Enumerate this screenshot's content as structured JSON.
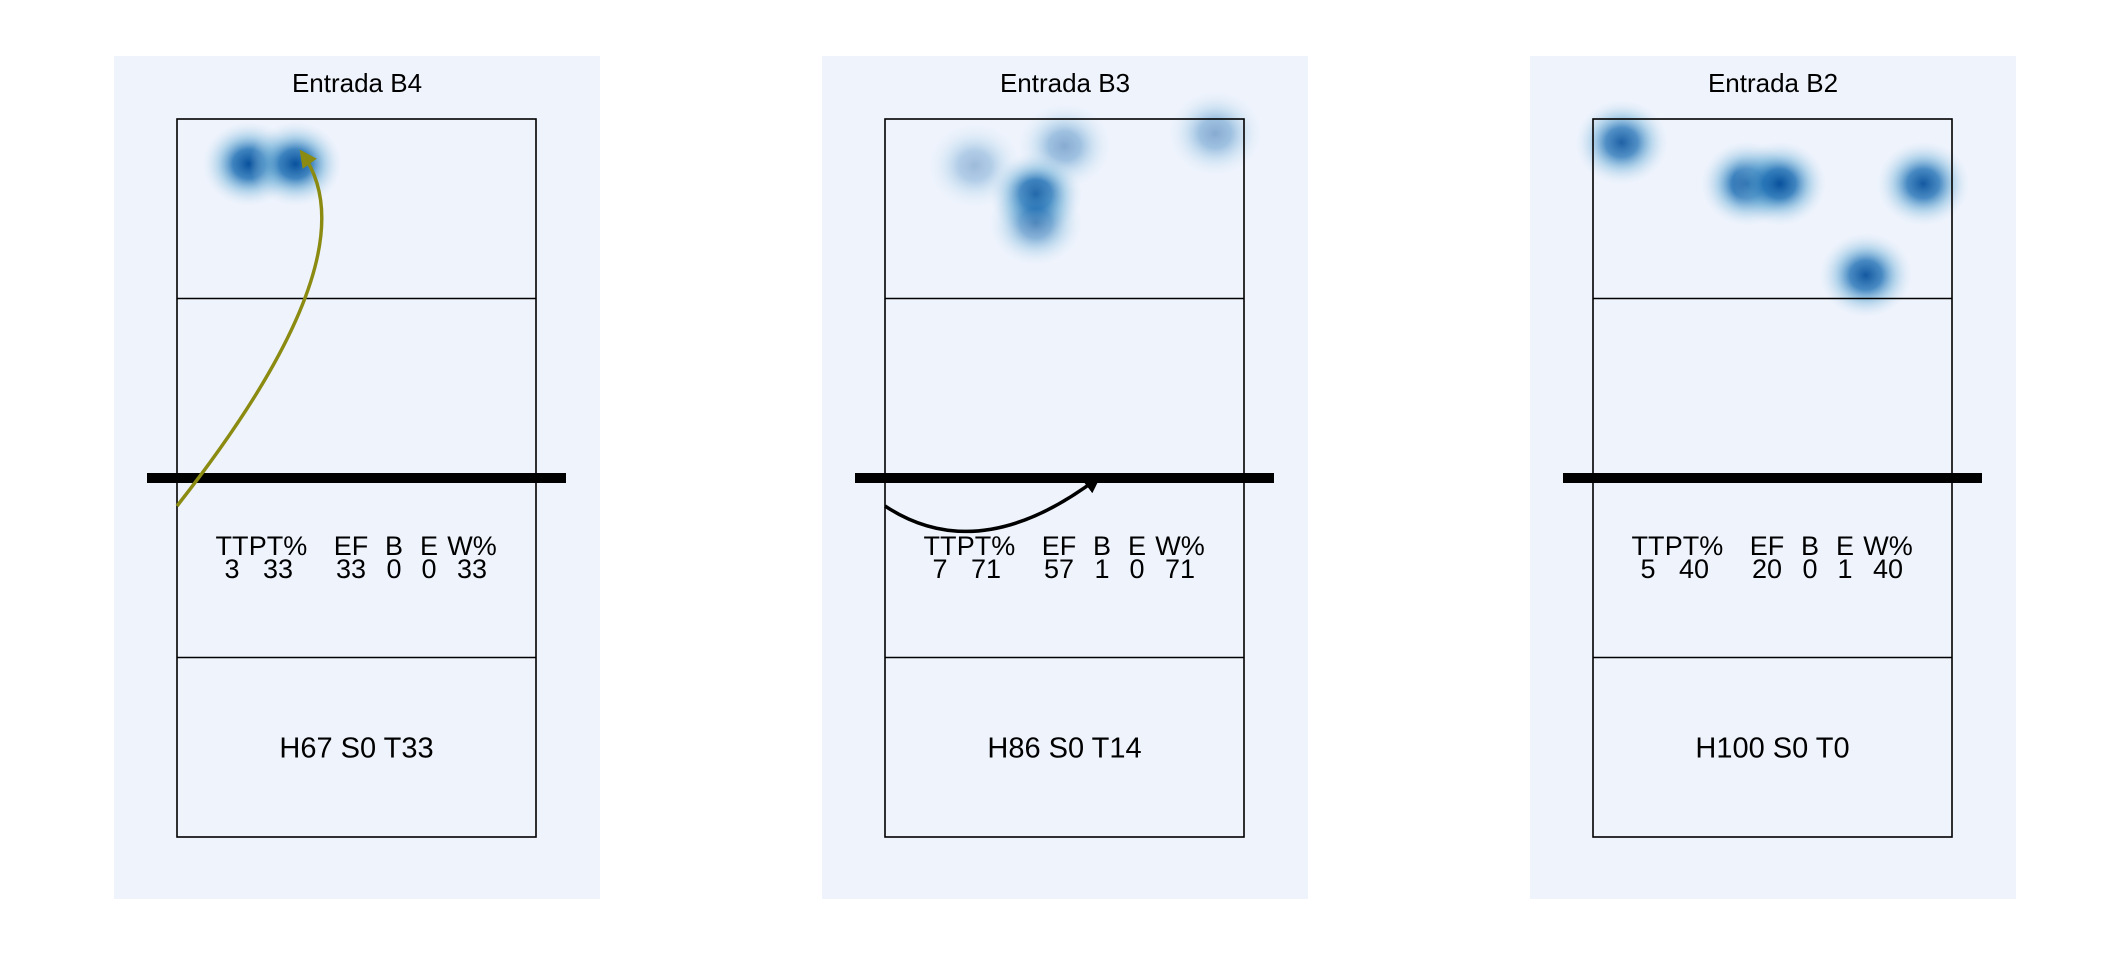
{
  "chart_data": [
    {
      "type": "heatmap",
      "title": "Entrada B4",
      "stats_header": [
        "TT",
        "PT%",
        "EF",
        "B",
        "E",
        "W%"
      ],
      "stats_values": [
        "3",
        "33",
        "33",
        "0",
        "0",
        "33"
      ],
      "code_label": "H67 S0 T33",
      "arrow_color": "#8b8b12",
      "hotspots": [
        {
          "x": 0.2,
          "y": 0.25,
          "intensity": 1.0
        },
        {
          "x": 0.33,
          "y": 0.25,
          "intensity": 1.0
        }
      ],
      "arrow": {
        "from": [
          0.0,
          1.0
        ],
        "to": [
          0.35,
          0.09
        ],
        "via": [
          0.55,
          0.35
        ]
      }
    },
    {
      "type": "heatmap",
      "title": "Entrada B3",
      "stats_header": [
        "TT",
        "PT%",
        "EF",
        "B",
        "E",
        "W%"
      ],
      "stats_values": [
        "7",
        "71",
        "57",
        "1",
        "0",
        "71"
      ],
      "code_label": "H86 S0 T14",
      "arrow_color": "#000000",
      "hotspots": [
        {
          "x": 0.25,
          "y": 0.26,
          "intensity": 0.35
        },
        {
          "x": 0.5,
          "y": 0.15,
          "intensity": 0.45
        },
        {
          "x": 0.92,
          "y": 0.08,
          "intensity": 0.45
        },
        {
          "x": 0.42,
          "y": 0.42,
          "intensity": 1.0
        },
        {
          "x": 0.42,
          "y": 0.58,
          "intensity": 0.6
        }
      ],
      "arrow": {
        "from": [
          0.0,
          1.0
        ],
        "to": [
          0.59,
          0.93
        ],
        "via": [
          0.26,
          1.16
        ]
      }
    },
    {
      "type": "heatmap",
      "title": "Entrada B2",
      "stats_header": [
        "TT",
        "PT%",
        "EF",
        "B",
        "E",
        "W%"
      ],
      "stats_values": [
        "5",
        "40",
        "20",
        "0",
        "1",
        "40"
      ],
      "code_label": "H100 S0 T0",
      "arrow_color": "#000000",
      "hotspots": [
        {
          "x": 0.08,
          "y": 0.13,
          "intensity": 0.9
        },
        {
          "x": 0.43,
          "y": 0.36,
          "intensity": 1.0
        },
        {
          "x": 0.52,
          "y": 0.36,
          "intensity": 1.0
        },
        {
          "x": 0.92,
          "y": 0.36,
          "intensity": 0.95
        },
        {
          "x": 0.76,
          "y": 0.87,
          "intensity": 0.95
        }
      ],
      "arrow": null
    }
  ]
}
